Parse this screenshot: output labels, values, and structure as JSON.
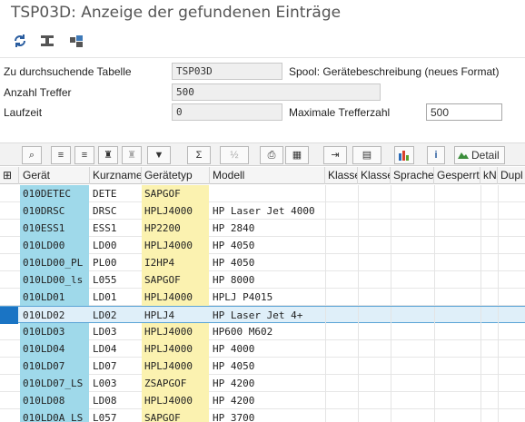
{
  "window": {
    "title": "TSP03D: Anzeige der gefundenen Einträge"
  },
  "app_toolbar": {
    "icons": [
      "refresh-icon",
      "filter-settings-icon",
      "puzzle-icon"
    ]
  },
  "form": {
    "table_label": "Zu durchsuchende Tabelle",
    "table_value": "TSP03D",
    "table_desc": "Spool: Gerätebeschreibung (neues Format)",
    "hits_label": "Anzahl Treffer",
    "hits_value": "500",
    "runtime_label": "Laufzeit",
    "runtime_value": "0",
    "maxhits_label": "Maximale Trefferzahl",
    "maxhits_value": "500"
  },
  "alv_toolbar": {
    "buttons": [
      "details-icon",
      "sort-asc-icon",
      "sort-desc-icon",
      "find-icon",
      "find-next-icon",
      "filter-icon",
      "sum-icon",
      "subtotal-icon",
      "print-icon",
      "views-icon",
      "export-icon",
      "layout-icon",
      "graphic-icon",
      "info-icon"
    ],
    "detail_label": "Detail"
  },
  "grid": {
    "columns": [
      "Gerät",
      "Kurzname",
      "Gerätetyp",
      "Modell",
      "Klasse",
      "Klasse",
      "Sprache",
      "Gesperrt",
      "kN",
      "Dupl"
    ],
    "rows": [
      {
        "geraet": "010DETEC",
        "kurz": "DETE",
        "typ": "SAPGOF",
        "modell": ""
      },
      {
        "geraet": "010DRSC",
        "kurz": "DRSC",
        "typ": "HPLJ4000",
        "modell": "HP Laser Jet 4000"
      },
      {
        "geraet": "010ESS1",
        "kurz": "ESS1",
        "typ": "HP2200",
        "modell": "HP 2840"
      },
      {
        "geraet": "010LD00",
        "kurz": "LD00",
        "typ": "HPLJ4000",
        "modell": "HP 4050"
      },
      {
        "geraet": "010LD00_PL",
        "kurz": "PL00",
        "typ": "I2HP4",
        "modell": "HP 4050"
      },
      {
        "geraet": "010LD00_ls",
        "kurz": "L055",
        "typ": "SAPGOF",
        "modell": "HP 8000"
      },
      {
        "geraet": "010LD01",
        "kurz": "LD01",
        "typ": "HPLJ4000",
        "modell": "HPLJ P4015"
      },
      {
        "geraet": "010LD02",
        "kurz": "LD02",
        "typ": "HPLJ4",
        "modell": "HP Laser Jet 4+"
      },
      {
        "geraet": "010LD03",
        "kurz": "LD03",
        "typ": "HPLJ4000",
        "modell": "HP600 M602"
      },
      {
        "geraet": "010LD04",
        "kurz": "LD04",
        "typ": "HPLJ4000",
        "modell": "HP 4000"
      },
      {
        "geraet": "010LD07",
        "kurz": "LD07",
        "typ": "HPLJ4000",
        "modell": "HP 4050"
      },
      {
        "geraet": "010LD07_LS",
        "kurz": "L003",
        "typ": "ZSAPGOF",
        "modell": "HP 4200"
      },
      {
        "geraet": "010LD08",
        "kurz": "LD08",
        "typ": "HPLJ4000",
        "modell": "HP 4200"
      },
      {
        "geraet": "010LD0A_LS",
        "kurz": "L057",
        "typ": "SAPGOF",
        "modell": "HP 3700"
      }
    ],
    "selected_index": 7
  },
  "colors": {
    "key_column": "#9fd9ea",
    "type_column": "#fbf2b0",
    "selection": "#1a74c4"
  }
}
